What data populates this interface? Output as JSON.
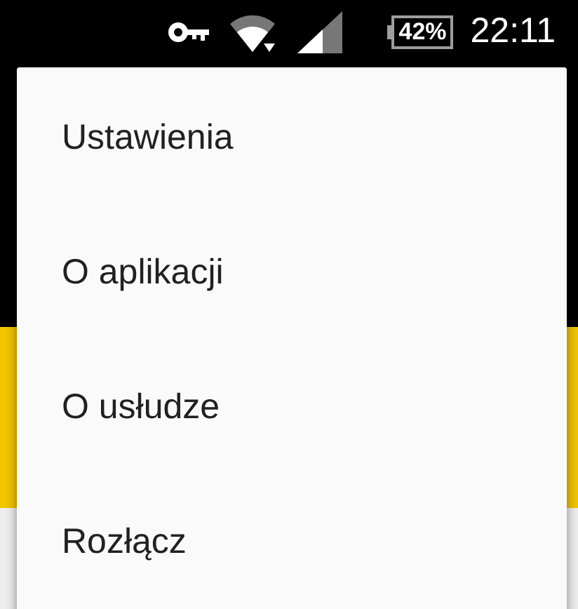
{
  "status_bar": {
    "battery": "42%",
    "time": "22:11"
  },
  "menu": {
    "items": [
      {
        "label": "Ustawienia"
      },
      {
        "label": "O aplikacji"
      },
      {
        "label": "O usłudze"
      },
      {
        "label": "Rozłącz"
      }
    ]
  }
}
